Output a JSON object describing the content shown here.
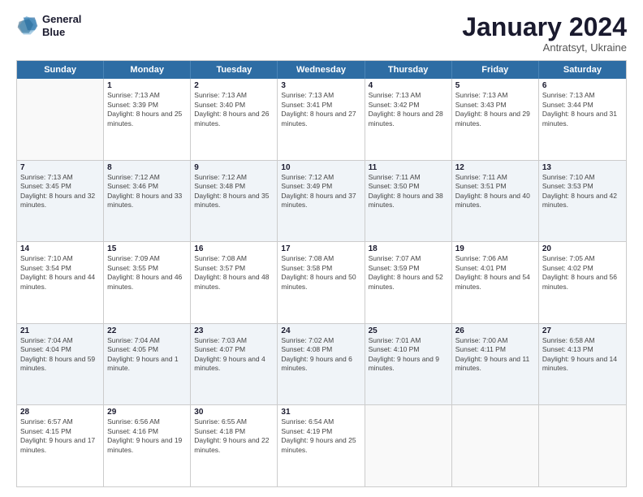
{
  "logo": {
    "line1": "General",
    "line2": "Blue"
  },
  "title": "January 2024",
  "subtitle": "Antratsyt, Ukraine",
  "days": [
    "Sunday",
    "Monday",
    "Tuesday",
    "Wednesday",
    "Thursday",
    "Friday",
    "Saturday"
  ],
  "rows": [
    [
      {
        "day": "",
        "sunrise": "",
        "sunset": "",
        "daylight": ""
      },
      {
        "day": "1",
        "sunrise": "Sunrise: 7:13 AM",
        "sunset": "Sunset: 3:39 PM",
        "daylight": "Daylight: 8 hours and 25 minutes."
      },
      {
        "day": "2",
        "sunrise": "Sunrise: 7:13 AM",
        "sunset": "Sunset: 3:40 PM",
        "daylight": "Daylight: 8 hours and 26 minutes."
      },
      {
        "day": "3",
        "sunrise": "Sunrise: 7:13 AM",
        "sunset": "Sunset: 3:41 PM",
        "daylight": "Daylight: 8 hours and 27 minutes."
      },
      {
        "day": "4",
        "sunrise": "Sunrise: 7:13 AM",
        "sunset": "Sunset: 3:42 PM",
        "daylight": "Daylight: 8 hours and 28 minutes."
      },
      {
        "day": "5",
        "sunrise": "Sunrise: 7:13 AM",
        "sunset": "Sunset: 3:43 PM",
        "daylight": "Daylight: 8 hours and 29 minutes."
      },
      {
        "day": "6",
        "sunrise": "Sunrise: 7:13 AM",
        "sunset": "Sunset: 3:44 PM",
        "daylight": "Daylight: 8 hours and 31 minutes."
      }
    ],
    [
      {
        "day": "7",
        "sunrise": "Sunrise: 7:13 AM",
        "sunset": "Sunset: 3:45 PM",
        "daylight": "Daylight: 8 hours and 32 minutes."
      },
      {
        "day": "8",
        "sunrise": "Sunrise: 7:12 AM",
        "sunset": "Sunset: 3:46 PM",
        "daylight": "Daylight: 8 hours and 33 minutes."
      },
      {
        "day": "9",
        "sunrise": "Sunrise: 7:12 AM",
        "sunset": "Sunset: 3:48 PM",
        "daylight": "Daylight: 8 hours and 35 minutes."
      },
      {
        "day": "10",
        "sunrise": "Sunrise: 7:12 AM",
        "sunset": "Sunset: 3:49 PM",
        "daylight": "Daylight: 8 hours and 37 minutes."
      },
      {
        "day": "11",
        "sunrise": "Sunrise: 7:11 AM",
        "sunset": "Sunset: 3:50 PM",
        "daylight": "Daylight: 8 hours and 38 minutes."
      },
      {
        "day": "12",
        "sunrise": "Sunrise: 7:11 AM",
        "sunset": "Sunset: 3:51 PM",
        "daylight": "Daylight: 8 hours and 40 minutes."
      },
      {
        "day": "13",
        "sunrise": "Sunrise: 7:10 AM",
        "sunset": "Sunset: 3:53 PM",
        "daylight": "Daylight: 8 hours and 42 minutes."
      }
    ],
    [
      {
        "day": "14",
        "sunrise": "Sunrise: 7:10 AM",
        "sunset": "Sunset: 3:54 PM",
        "daylight": "Daylight: 8 hours and 44 minutes."
      },
      {
        "day": "15",
        "sunrise": "Sunrise: 7:09 AM",
        "sunset": "Sunset: 3:55 PM",
        "daylight": "Daylight: 8 hours and 46 minutes."
      },
      {
        "day": "16",
        "sunrise": "Sunrise: 7:08 AM",
        "sunset": "Sunset: 3:57 PM",
        "daylight": "Daylight: 8 hours and 48 minutes."
      },
      {
        "day": "17",
        "sunrise": "Sunrise: 7:08 AM",
        "sunset": "Sunset: 3:58 PM",
        "daylight": "Daylight: 8 hours and 50 minutes."
      },
      {
        "day": "18",
        "sunrise": "Sunrise: 7:07 AM",
        "sunset": "Sunset: 3:59 PM",
        "daylight": "Daylight: 8 hours and 52 minutes."
      },
      {
        "day": "19",
        "sunrise": "Sunrise: 7:06 AM",
        "sunset": "Sunset: 4:01 PM",
        "daylight": "Daylight: 8 hours and 54 minutes."
      },
      {
        "day": "20",
        "sunrise": "Sunrise: 7:05 AM",
        "sunset": "Sunset: 4:02 PM",
        "daylight": "Daylight: 8 hours and 56 minutes."
      }
    ],
    [
      {
        "day": "21",
        "sunrise": "Sunrise: 7:04 AM",
        "sunset": "Sunset: 4:04 PM",
        "daylight": "Daylight: 8 hours and 59 minutes."
      },
      {
        "day": "22",
        "sunrise": "Sunrise: 7:04 AM",
        "sunset": "Sunset: 4:05 PM",
        "daylight": "Daylight: 9 hours and 1 minute."
      },
      {
        "day": "23",
        "sunrise": "Sunrise: 7:03 AM",
        "sunset": "Sunset: 4:07 PM",
        "daylight": "Daylight: 9 hours and 4 minutes."
      },
      {
        "day": "24",
        "sunrise": "Sunrise: 7:02 AM",
        "sunset": "Sunset: 4:08 PM",
        "daylight": "Daylight: 9 hours and 6 minutes."
      },
      {
        "day": "25",
        "sunrise": "Sunrise: 7:01 AM",
        "sunset": "Sunset: 4:10 PM",
        "daylight": "Daylight: 9 hours and 9 minutes."
      },
      {
        "day": "26",
        "sunrise": "Sunrise: 7:00 AM",
        "sunset": "Sunset: 4:11 PM",
        "daylight": "Daylight: 9 hours and 11 minutes."
      },
      {
        "day": "27",
        "sunrise": "Sunrise: 6:58 AM",
        "sunset": "Sunset: 4:13 PM",
        "daylight": "Daylight: 9 hours and 14 minutes."
      }
    ],
    [
      {
        "day": "28",
        "sunrise": "Sunrise: 6:57 AM",
        "sunset": "Sunset: 4:15 PM",
        "daylight": "Daylight: 9 hours and 17 minutes."
      },
      {
        "day": "29",
        "sunrise": "Sunrise: 6:56 AM",
        "sunset": "Sunset: 4:16 PM",
        "daylight": "Daylight: 9 hours and 19 minutes."
      },
      {
        "day": "30",
        "sunrise": "Sunrise: 6:55 AM",
        "sunset": "Sunset: 4:18 PM",
        "daylight": "Daylight: 9 hours and 22 minutes."
      },
      {
        "day": "31",
        "sunrise": "Sunrise: 6:54 AM",
        "sunset": "Sunset: 4:19 PM",
        "daylight": "Daylight: 9 hours and 25 minutes."
      },
      {
        "day": "",
        "sunrise": "",
        "sunset": "",
        "daylight": ""
      },
      {
        "day": "",
        "sunrise": "",
        "sunset": "",
        "daylight": ""
      },
      {
        "day": "",
        "sunrise": "",
        "sunset": "",
        "daylight": ""
      }
    ]
  ]
}
